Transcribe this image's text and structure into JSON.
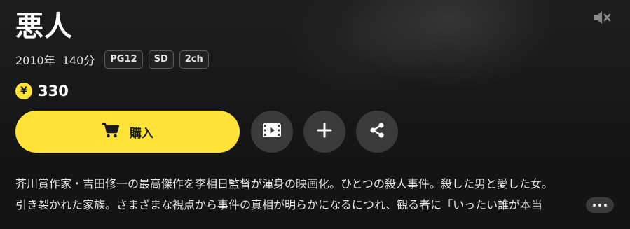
{
  "title": "悪人",
  "meta": {
    "year": "2010年",
    "duration": "140分",
    "badges": [
      "PG12",
      "SD",
      "2ch"
    ]
  },
  "price": {
    "currency_symbol": "¥",
    "amount": "330"
  },
  "actions": {
    "buy_label": "購入"
  },
  "description": {
    "line1": "芥川賞作家・吉田修一の最高傑作を李相日監督が渾身の映画化。ひとつの殺人事件。殺した男と愛した女。",
    "line2": "引き裂かれた家族。さまざまな視点から事件の真相が明らかになるにつれ、観る者に「いったい誰が本当"
  },
  "icons": {
    "mute": "volume-mute-icon",
    "cart": "cart-icon",
    "trailer": "film-icon",
    "add": "plus-icon",
    "share": "share-icon",
    "more": "ellipsis-icon"
  },
  "colors": {
    "accent": "#ffe338",
    "background": "#141414",
    "round_button": "#3a3a3a"
  }
}
